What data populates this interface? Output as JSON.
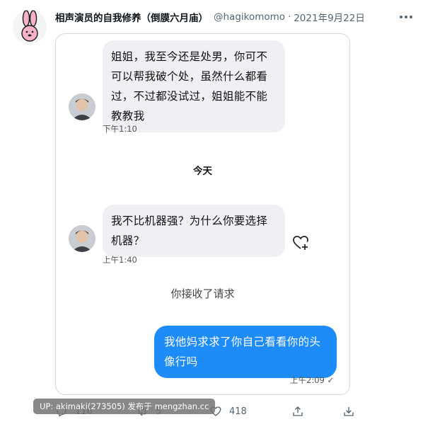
{
  "tweet": {
    "author_name": "相声演员的自我修养（倒膜六月庙）",
    "author_handle": "@hagikomomo",
    "separator": "·",
    "date": "2021年9月22日",
    "avatar_icon": "pink-bunny-avatar-icon",
    "more_icon": "more-horizontal-icon"
  },
  "chat": {
    "messages": [
      {
        "sender": "other",
        "text_lines": [
          "姐姐，我至今还是处男，你可不",
          "可以帮我破个处，虽然什么都看",
          "过，不过都没试过，姐姐能不能",
          "教教我"
        ],
        "time": "下午1:10"
      },
      {
        "sender": "other",
        "text_lines": [
          "我不比机器强？为什么你要选择",
          "机器？"
        ],
        "time": "上午1:40"
      },
      {
        "sender": "me",
        "text_lines": [
          "我他妈求求了你自己看看你的头",
          "像行吗"
        ],
        "time": "上午2:09 ✓"
      }
    ],
    "day_label": "今天",
    "system_label": "你接收了请求",
    "react_icon": "heart-plus-icon"
  },
  "actions": {
    "reply": {
      "icon": "reply-icon",
      "count": "116"
    },
    "retweet": {
      "icon": "retweet-icon",
      "count": "5"
    },
    "like": {
      "icon": "heart-icon",
      "count": "418"
    },
    "share": {
      "icon": "share-icon"
    },
    "bookmark": {
      "icon": "download-icon"
    }
  },
  "watermark": {
    "text": "UP: akimaki(273505) 发布于 mengzhan.cc"
  },
  "colors": {
    "accent_blue": "#1d8cf8",
    "bubble_gray": "#eef0f3",
    "muted": "#536471"
  }
}
